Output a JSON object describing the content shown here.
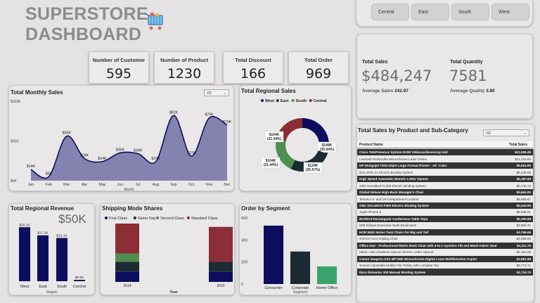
{
  "header": {
    "title_line1": "SUPERSTORE",
    "title_line2": "DASHBOARD"
  },
  "regions": [
    "Central",
    "East",
    "South",
    "West"
  ],
  "kpis": [
    {
      "label": "Number of Customer",
      "value": "595"
    },
    {
      "label": "Number of Product",
      "value": "1230"
    },
    {
      "label": "Total Discount",
      "value": "166"
    },
    {
      "label": "Total Order",
      "value": "969"
    }
  ],
  "totals": {
    "sales_label": "Total Sales",
    "sales_value": "$484,247",
    "qty_label": "Total Quantity",
    "qty_value": "7581",
    "avg_sales_label": "Average Sales",
    "avg_sales_value": "242.97",
    "avg_qty_label": "Average Quality",
    "avg_qty_value": "3.80"
  },
  "colors": {
    "navy": "#0d0d5e",
    "green": "#4f8e4f",
    "red": "#8b2e36",
    "dark": "#1c2a33",
    "teal": "#3aa26b",
    "area": "#7b77a8"
  },
  "dropdown_all": "All",
  "chart_data": [
    {
      "id": "monthly",
      "type": "area",
      "title": "Total Monthly Sales",
      "xlabel": "Month",
      "ylabel": "",
      "categories": [
        "Jan",
        "Feb",
        "Mar",
        "Apr",
        "May",
        "Jun",
        "Jul",
        "Aug",
        "Sep",
        "Oct",
        "Nov",
        "Dec"
      ],
      "values": [
        14,
        5,
        56,
        28,
        24,
        35,
        34,
        24,
        82,
        31,
        79,
        70
      ],
      "data_labels": [
        "$14K",
        "$5K",
        "$56K",
        "$28K",
        "$24K",
        "$35K",
        "$34K",
        "$24K",
        "$82K",
        "$31K",
        "$79K",
        "$70K"
      ],
      "yticks": [
        "$0K",
        "$50K",
        "$100K"
      ],
      "ylim": [
        0,
        100
      ]
    },
    {
      "id": "regional_donut",
      "type": "pie",
      "title": "Total Regional Sales",
      "legend": [
        {
          "name": "West",
          "color": "#0d0d5e"
        },
        {
          "name": "East",
          "color": "#1c2a33"
        },
        {
          "name": "South",
          "color": "#4f8e4f"
        },
        {
          "name": "Central",
          "color": "#8b2e36"
        }
      ],
      "slices": [
        {
          "name": "West",
          "value": 148,
          "label": "$148K\n(30.54%)",
          "color": "#0d0d5e"
        },
        {
          "name": "East",
          "value": 129,
          "label": "$129K\n(26.57%)",
          "color": "#1c2a33"
        },
        {
          "name": "South",
          "value": 104,
          "label": "$104K\n(21.44%)",
          "color": "#4f8e4f"
        },
        {
          "name": "Central",
          "value": 104,
          "label": "$104K\n(21.44%)",
          "color": "#8b2e36"
        }
      ]
    },
    {
      "id": "regional_revenue",
      "type": "bar",
      "title": "Total Regional Revenue",
      "big_value": "$50K",
      "xlabel": "Region",
      "categories": [
        "West",
        "East",
        "South",
        "Central"
      ],
      "values": [
        20.1,
        17.1,
        16.1,
        0.5
      ],
      "data_labels": [
        "$20.1K",
        "$17.1K",
        "$16.1K",
        "$0.5K"
      ],
      "ylim": [
        0,
        22
      ]
    },
    {
      "id": "shipping",
      "type": "bar",
      "title": "Shipping Mode Shares",
      "xlabel": "Year",
      "categories": [
        "2014",
        "2015"
      ],
      "series": [
        {
          "name": "First Class",
          "color": "#0d0d5e",
          "values": [
            0.12,
            0.12
          ]
        },
        {
          "name": "Same Day",
          "color": "#1c2a33",
          "values": [
            0.12,
            0.12
          ]
        },
        {
          "name": "Second Class",
          "color": "#4f8e4f",
          "values": [
            0.1,
            0.0
          ]
        },
        {
          "name": "Standard Class",
          "color": "#8b2e36",
          "values": [
            0.36,
            0.42
          ]
        }
      ]
    },
    {
      "id": "segment",
      "type": "bar",
      "title": "Order by Segment",
      "xlabel": "Segment",
      "categories": [
        "Consumer",
        "Corporate",
        "Home Office"
      ],
      "values": [
        530,
        295,
        160
      ],
      "colors": [
        "#0d0d5e",
        "#1c2a33",
        "#3aa26b"
      ],
      "yticks": [
        "0",
        "200",
        "400",
        "600"
      ],
      "ylim": [
        0,
        600
      ]
    }
  ],
  "product_table": {
    "title": "Total Sales by Product and Sub-Category",
    "col_product": "Product Name",
    "col_sales": "Total Sales",
    "rows": [
      {
        "name": "Cisco TelePresence System EX90 Videoconferencing Unit",
        "sales": "$22,638.48"
      },
      {
        "name": "Lexmark MX611dhe Monochrome Laser Printer",
        "sales": "$11,219.93"
      },
      {
        "name": "HP Designjet T520 Inkjet Large Format Printer - 24\" Color",
        "sales": "$9,624.95"
      },
      {
        "name": "Ibico EPK-21 Electric Binding System",
        "sales": "$9,449.95"
      },
      {
        "name": "High Speed Automatic Electric Letter Opener",
        "sales": "$8,187.65"
      },
      {
        "name": "GBC DocuBind TL300 Electric Binding System",
        "sales": "$5,740.74"
      },
      {
        "name": "Global Deluxe High-Back Manager's Chair",
        "sales": "$5,664.00"
      },
      {
        "name": "Tennsco 6- and 18-Compartment Lockers",
        "sales": "$5,568.57"
      },
      {
        "name": "GBC DocuBind P400 Electric Binding System",
        "sales": "$5,443.96"
      },
      {
        "name": "Apple iPhone 5",
        "sales": "$5,528.61"
      },
      {
        "name": "Bretford Rectangular Conference Table Tops",
        "sales": "$5,190.59"
      },
      {
        "name": "DMI Eclipse Executive Suite Bookcases",
        "sales": "$4,809.41"
      },
      {
        "name": "HON 5400 Series Task Chairs for Big and Tall",
        "sales": "$4,766.66"
      },
      {
        "name": "SAFCO Arco Folding Chair",
        "sales": "$4,495.00"
      },
      {
        "name": "Office Star - Professional Matrix Back Chair with 2-to-1 Synchro Tilt and Mesh Fabric Seat",
        "sales": "$4,211.76"
      },
      {
        "name": "Martin Yale Chadless Opener Electric Letter Opener",
        "sales": "$4,164.05"
      },
      {
        "name": "Canon imageCLASS MF7460 Monochrome Digital Laser Multifunction Copier",
        "sales": "$3,991.98"
      },
      {
        "name": "Smead Adjustable Mobile File Trolley with Lockable Top",
        "sales": "$3,772.71"
      },
      {
        "name": "Ibico Ibimaster 300 Manual Binding System",
        "sales": "$3,716.70"
      }
    ]
  }
}
